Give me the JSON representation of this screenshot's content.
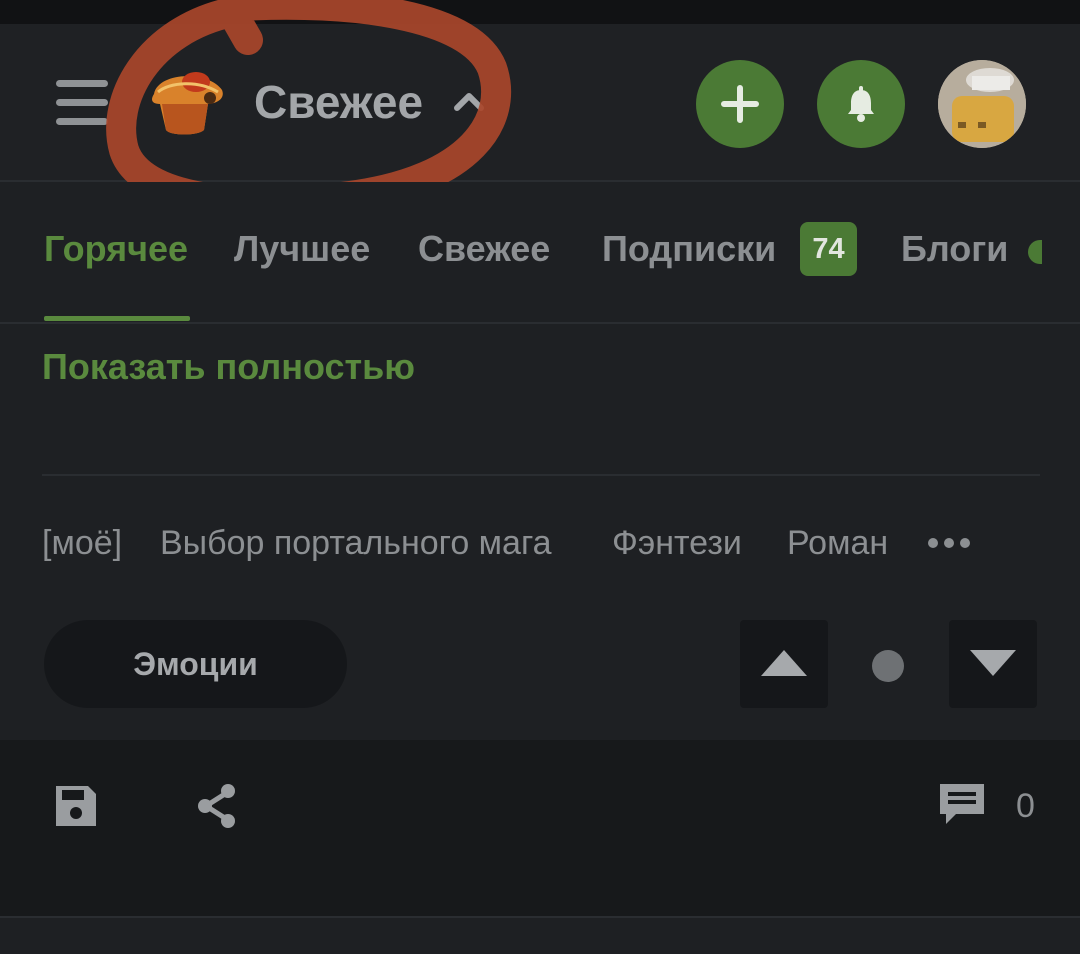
{
  "header": {
    "title": "Свежее",
    "menu_icon": "hamburger-menu-icon",
    "logo_icon": "muffin-logo-icon",
    "add_icon": "plus-icon",
    "notifications_icon": "bell-icon",
    "accent_color": "#4b7a35"
  },
  "tabs": {
    "items": [
      {
        "label": "Горячее",
        "active": true
      },
      {
        "label": "Лучшее",
        "active": false
      },
      {
        "label": "Свежее",
        "active": false
      },
      {
        "label": "Подписки",
        "active": false,
        "badge": "74"
      },
      {
        "label": "Блоги",
        "active": false
      }
    ]
  },
  "post": {
    "show_full_label": "Показать полностью",
    "tags": [
      "[моё]",
      "Выбор портального мага",
      "Фэнтези",
      "Роман"
    ],
    "more_icon": "more-dots-icon",
    "emotions_label": "Эмоции",
    "vote_up_icon": "triangle-up-icon",
    "vote_down_icon": "triangle-down-icon",
    "save_icon": "save-icon",
    "share_icon": "share-icon",
    "comment_icon": "comment-icon",
    "comments_count": "0"
  }
}
